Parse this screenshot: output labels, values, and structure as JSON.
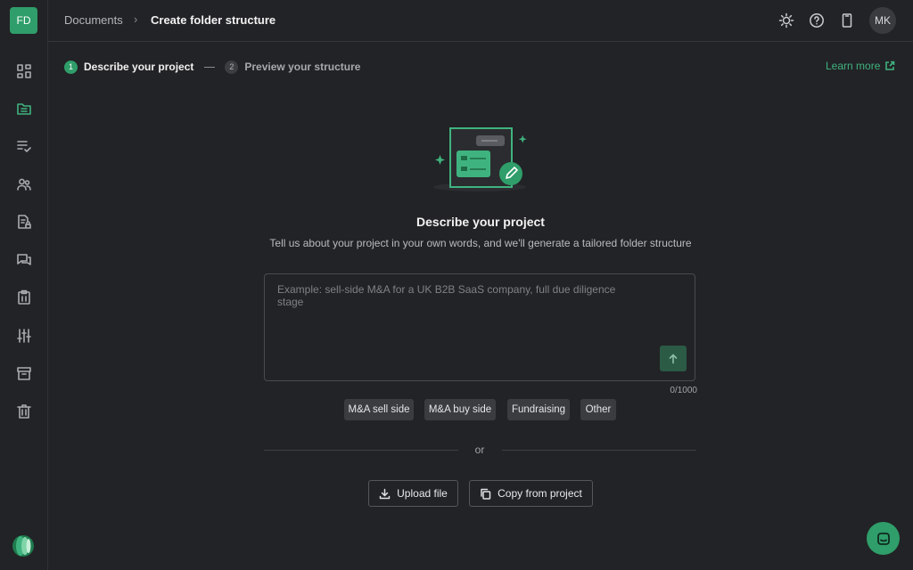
{
  "workspace": {
    "initials": "FD"
  },
  "breadcrumb": {
    "root": "Documents",
    "separator": "›",
    "current": "Create folder structure"
  },
  "user": {
    "initials": "MK"
  },
  "sidebar": {
    "items": [
      {
        "icon": "dashboard-icon"
      },
      {
        "icon": "folder-icon",
        "active": true
      },
      {
        "icon": "task-list-icon"
      },
      {
        "icon": "users-icon"
      },
      {
        "icon": "document-lock-icon"
      },
      {
        "icon": "chat-icon"
      },
      {
        "icon": "clipboard-icon"
      },
      {
        "icon": "sliders-icon"
      },
      {
        "icon": "archive-icon"
      },
      {
        "icon": "trash-icon"
      }
    ]
  },
  "stepper": {
    "steps": [
      {
        "number": "1",
        "label": "Describe your project",
        "active": true
      },
      {
        "number": "2",
        "label": "Preview your structure",
        "active": false
      }
    ]
  },
  "learn_more": "Learn more",
  "main": {
    "heading": "Describe your project",
    "subheading": "Tell us about your project in your own words, and we'll generate a tailored folder structure",
    "input_placeholder": "Example: sell-side M&A for a UK B2B SaaS company, full due diligence stage",
    "input_value": "",
    "char_count": "0/1000",
    "chips": [
      "M&A sell side",
      "M&A buy side",
      "Fundraising",
      "Other"
    ],
    "or_label": "or",
    "upload_label": "Upload file",
    "copy_label": "Copy from project"
  },
  "colors": {
    "accent": "#2f9e6a",
    "background": "#222326",
    "chip": "#3b3c40"
  }
}
